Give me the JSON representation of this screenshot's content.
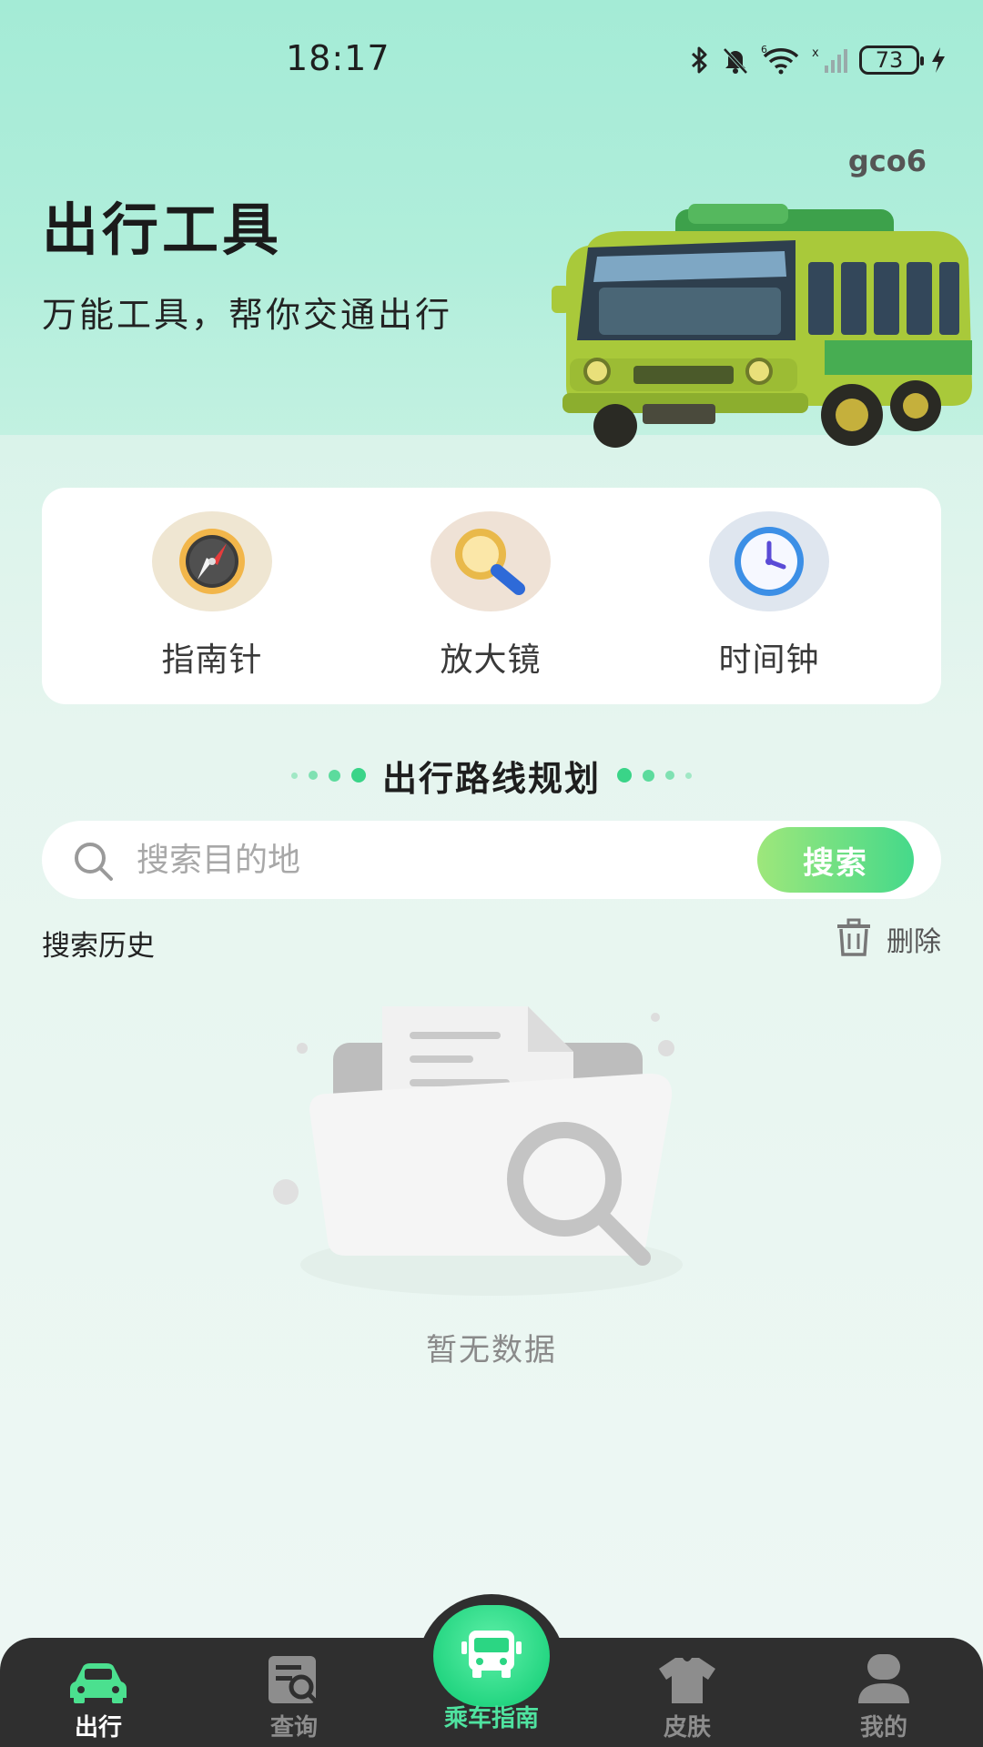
{
  "status_bar": {
    "time": "18:17",
    "battery": "73",
    "icons": [
      "bluetooth-icon",
      "mute-bell-icon",
      "wifi-6-icon",
      "signal-none-icon",
      "battery-icon",
      "charging-icon"
    ]
  },
  "header": {
    "user_tag": "gco6",
    "title": "出行工具",
    "subtitle": "万能工具，帮你交通出行",
    "illustration": "bus-illustration"
  },
  "tools": [
    {
      "label": "指南针",
      "icon": "compass-icon"
    },
    {
      "label": "放大镜",
      "icon": "magnifier-icon"
    },
    {
      "label": "时间钟",
      "icon": "clock-icon"
    }
  ],
  "route_section": {
    "title": "出行路线规划"
  },
  "search": {
    "placeholder": "搜索目的地",
    "value": "",
    "button_label": "搜索"
  },
  "history": {
    "label": "搜索历史",
    "delete_label": "删除",
    "empty_text": "暂无数据"
  },
  "bottom_nav": {
    "items": [
      {
        "label": "出行",
        "icon": "car-icon",
        "active": true
      },
      {
        "label": "查询",
        "icon": "query-icon",
        "active": false
      },
      {
        "label": "乘车指南",
        "icon": "bus-icon",
        "active": false
      },
      {
        "label": "皮肤",
        "icon": "tshirt-icon",
        "active": false
      },
      {
        "label": "我的",
        "icon": "user-icon",
        "active": false
      }
    ]
  },
  "colors": {
    "accent_green": "#3ad488",
    "nav_bg": "#2f2f2f",
    "hero_bg": "#a6ecd8"
  }
}
